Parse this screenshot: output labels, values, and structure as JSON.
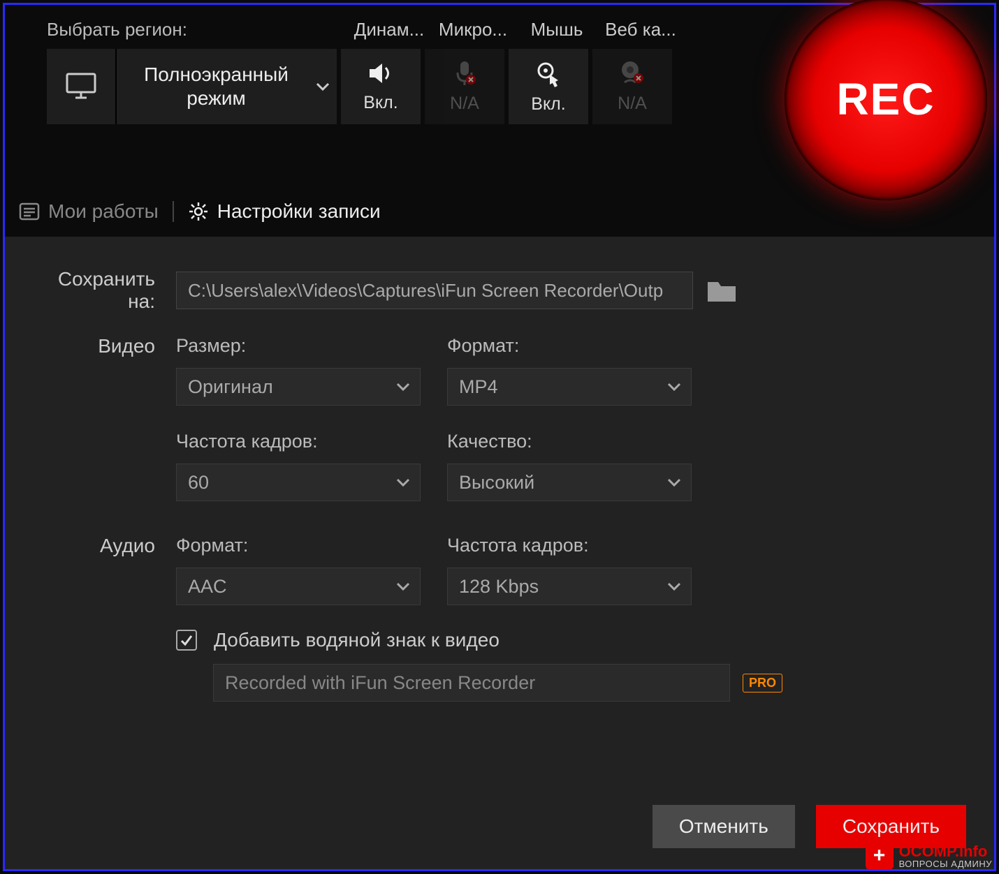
{
  "toolbar": {
    "region_label": "Выбрать регион:",
    "region_mode": "Полноэкранный режим",
    "toggles": [
      {
        "header": "Динам...",
        "status": "Вкл.",
        "enabled": true,
        "icon": "speaker-icon"
      },
      {
        "header": "Микро...",
        "status": "N/A",
        "enabled": false,
        "icon": "mic-icon"
      },
      {
        "header": "Мышь",
        "status": "Вкл.",
        "enabled": true,
        "icon": "cursor-icon"
      },
      {
        "header": "Веб ка...",
        "status": "N/A",
        "enabled": false,
        "icon": "webcam-icon"
      }
    ],
    "rec_label": "REC"
  },
  "tabs": {
    "works": "Мои работы",
    "settings": "Настройки записи"
  },
  "settings": {
    "save_to_label": "Сохранить на:",
    "save_path": "C:\\Users\\alex\\Videos\\Captures\\iFun Screen Recorder\\Outp",
    "video_section": "Видео",
    "audio_section": "Аудио",
    "video": {
      "size_label": "Размер:",
      "size_value": "Оригинал",
      "format_label": "Формат:",
      "format_value": "MP4",
      "fps_label": "Частота кадров:",
      "fps_value": "60",
      "quality_label": "Качество:",
      "quality_value": "Высокий"
    },
    "audio": {
      "format_label": "Формат:",
      "format_value": "AAC",
      "bitrate_label": "Частота кадров:",
      "bitrate_value": "128 Kbps"
    },
    "watermark": {
      "checked": true,
      "label": "Добавить водяной знак к видео",
      "text": "Recorded with iFun Screen Recorder",
      "pro_badge": "PRO"
    },
    "buttons": {
      "cancel": "Отменить",
      "save": "Сохранить"
    }
  },
  "site_watermark": {
    "main": "OCOMP",
    "suffix": ".info",
    "sub": "ВОПРОСЫ АДМИНУ"
  }
}
